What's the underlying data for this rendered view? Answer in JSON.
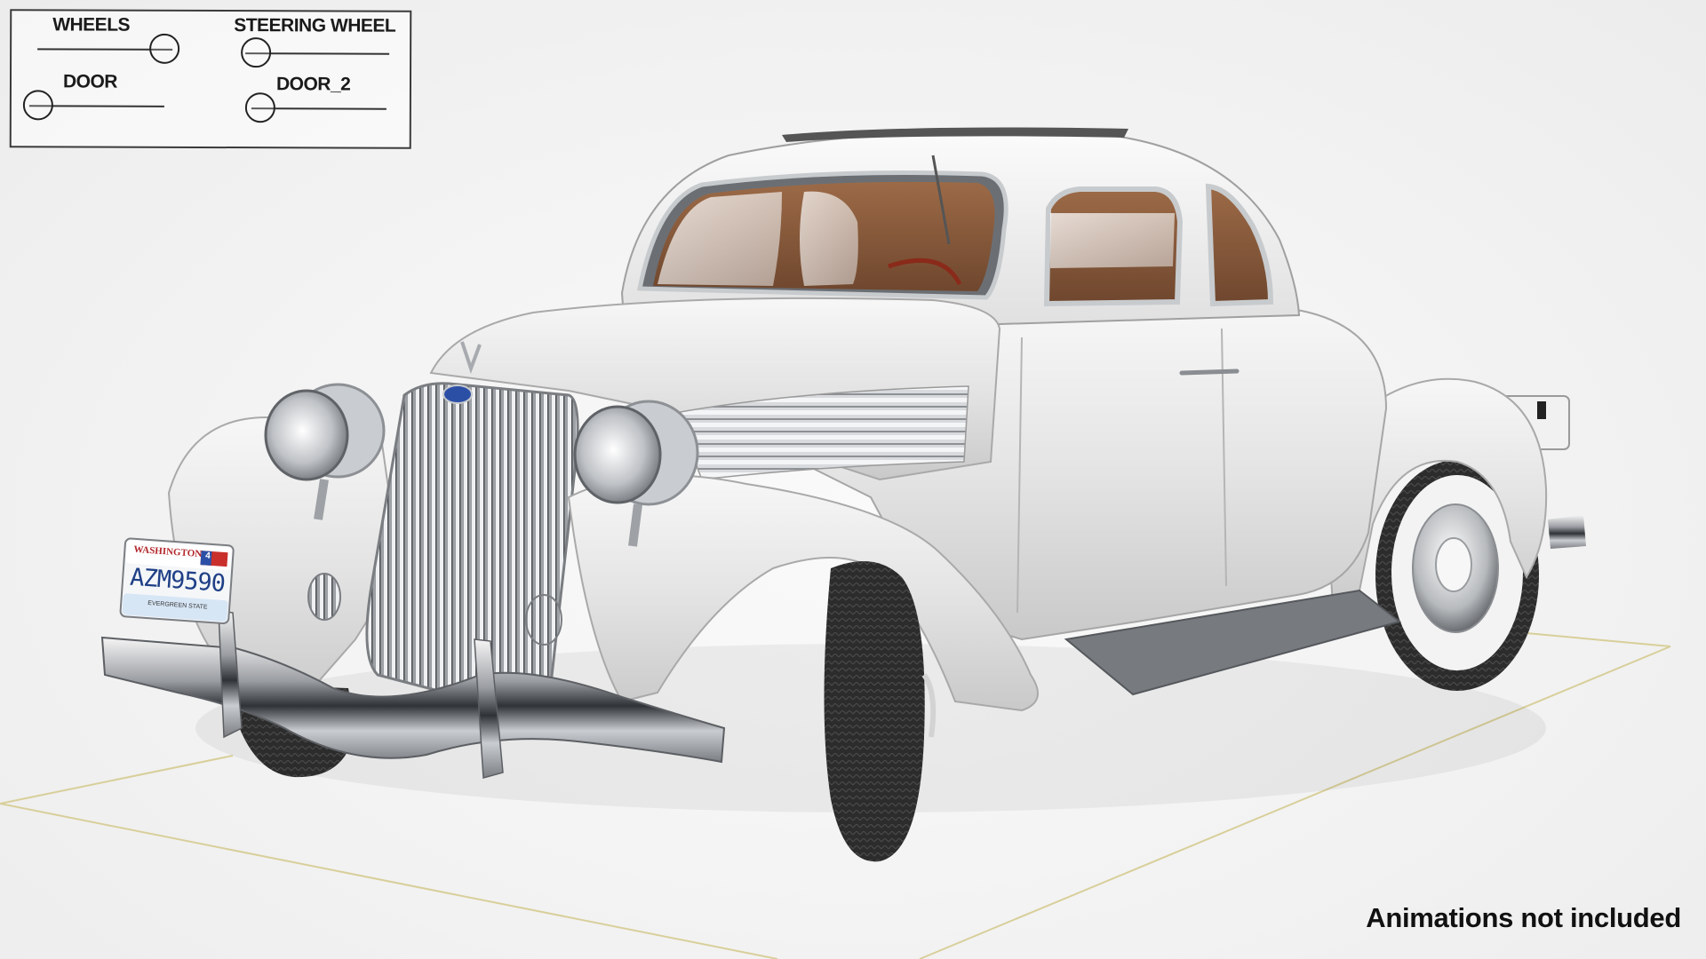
{
  "rig_panel": {
    "controls": [
      {
        "label": "WHEELS",
        "knob": "right"
      },
      {
        "label": "STEERING WHEEL",
        "knob": "left"
      },
      {
        "label": "DOOR",
        "knob": "left"
      },
      {
        "label": "DOOR_2",
        "knob": "left"
      }
    ]
  },
  "license_plate": {
    "state": "WASHINGTON",
    "number": "AZM9590",
    "motto": "EVERGREEN STATE",
    "sticker": "4"
  },
  "footer": {
    "note": "Animations not included"
  },
  "colors": {
    "body": "#e6e6e6",
    "chrome": "#b9bcc0",
    "tire": "#2b2b2b",
    "whitewall": "#f2f2f2",
    "interior": "#8a5a3b",
    "ground_line": "#d8cf9a"
  }
}
